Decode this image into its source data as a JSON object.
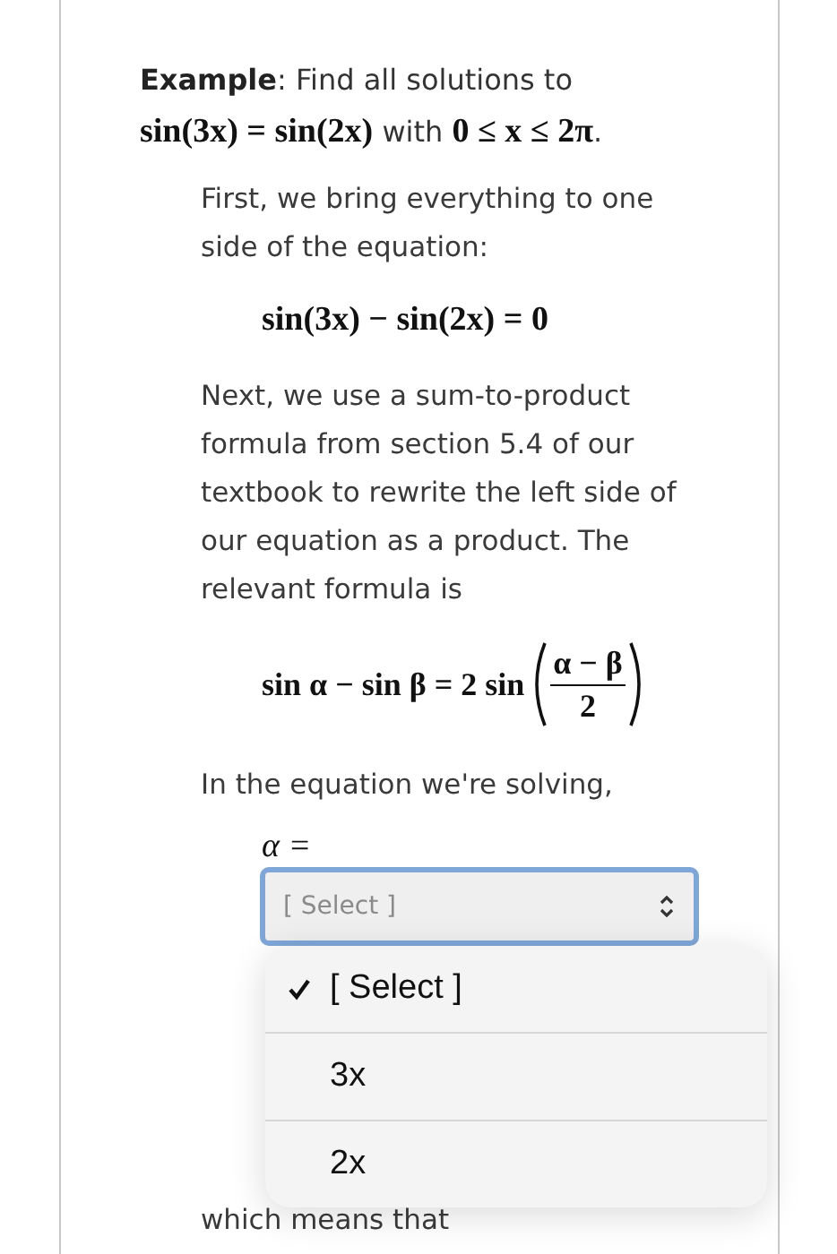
{
  "intro": [
    {
      "kind": "bold",
      "text": "Example"
    },
    {
      "kind": "text",
      "text": ": Find all solutions to"
    },
    {
      "kind": "break"
    },
    {
      "kind": "math",
      "text": "sin(3x) = sin(2x)"
    },
    {
      "kind": "text",
      "text": " with "
    },
    {
      "kind": "math",
      "text": "0 ≤ x ≤ 2π"
    },
    {
      "kind": "text",
      "text": "."
    }
  ],
  "steps": [
    {
      "kind": "paragraph",
      "text": "First, we bring everything to one side of the equation:"
    },
    {
      "kind": "equation",
      "text": "sin(3x) − sin(2x) = 0"
    },
    {
      "kind": "paragraph",
      "text": "Next, we use a sum-to-product formula from section 5.4 of our textbook to rewrite the left side of our equation as a product. The relevant formula is"
    },
    {
      "kind": "formula",
      "text": "sin α − sin β = 2 sin",
      "numerator": "α − β",
      "denominator": "2"
    },
    {
      "kind": "paragraph",
      "text": "In the equation we're solving,"
    },
    {
      "kind": "select",
      "label": "α =",
      "value": "[ Select ]"
    },
    {
      "kind": "paragraph",
      "text": "which means that"
    }
  ],
  "menu": [
    {
      "label": "[ Select ]",
      "selected": true
    },
    {
      "label": "3x",
      "selected": false
    },
    {
      "label": "2x",
      "selected": false
    }
  ]
}
